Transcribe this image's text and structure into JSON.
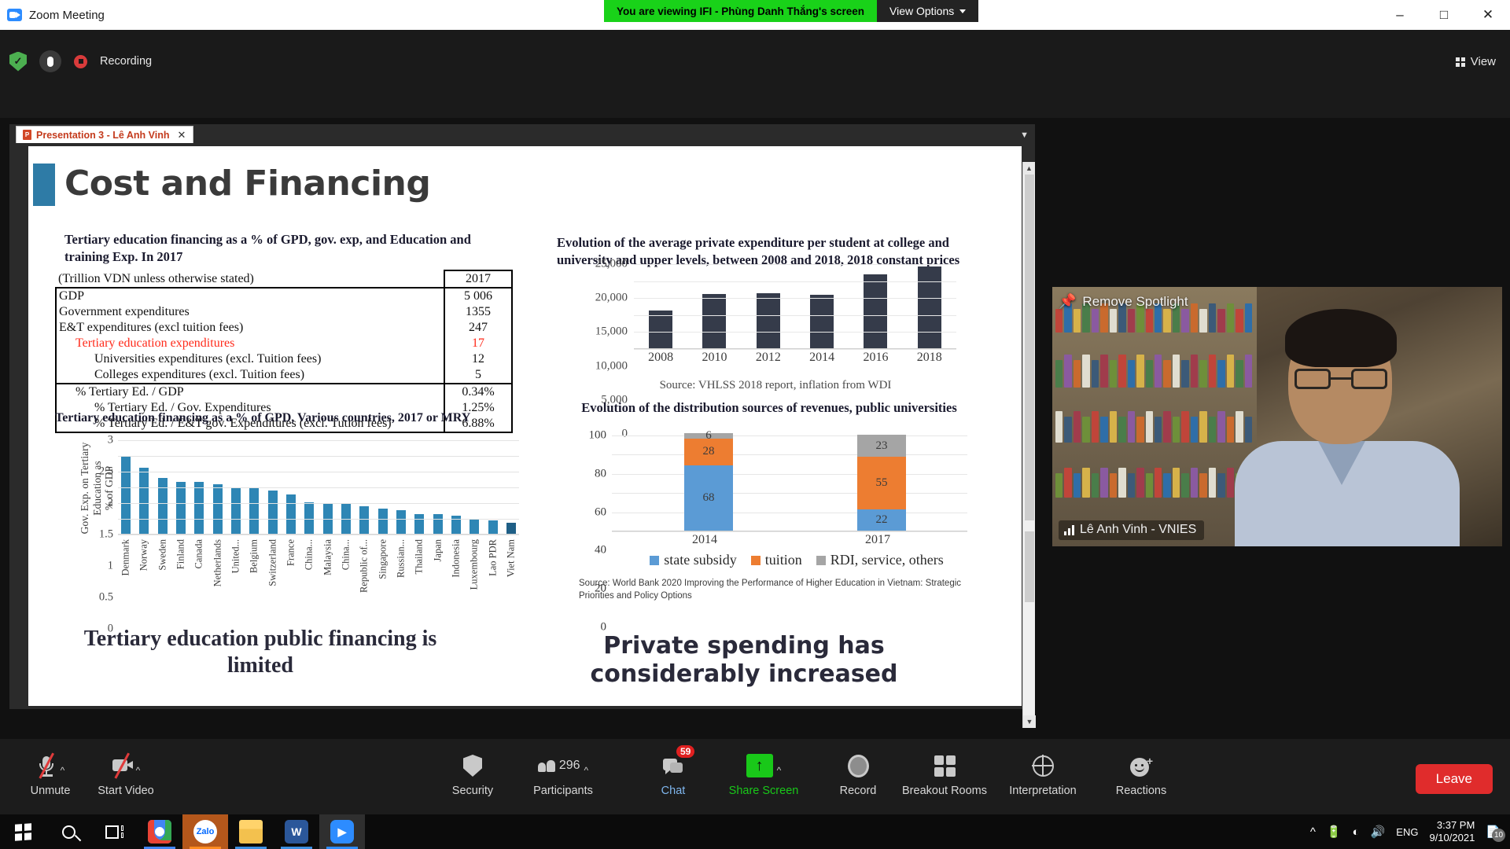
{
  "window": {
    "app_title": "Zoom Meeting",
    "viewing_banner": "You are viewing IFI - Phùng Danh Thắng's screen",
    "view_options": "View Options",
    "minimize": "–",
    "maximize": "□",
    "close": "✕"
  },
  "topbar": {
    "recording_label": "Recording",
    "view_label": "View"
  },
  "share_window": {
    "tab_label": "Presentation 3 - Lê Anh Vinh",
    "tab_close": "✕"
  },
  "slide": {
    "title": "Cost and Financing",
    "left_heading": "Tertiary education financing as a % of GPD, gov. exp, and Education and training Exp. In 2017",
    "table": {
      "header_label": "(Trillion VDN unless otherwise stated)",
      "header_value": "2017",
      "rows": [
        {
          "label": "GDP",
          "value": "5 006",
          "indent": 0,
          "red": false
        },
        {
          "label": "Government expenditures",
          "value": "1355",
          "indent": 0,
          "red": false
        },
        {
          "label": "E&T expenditures (excl tuition fees)",
          "value": "247",
          "indent": 0,
          "red": false
        },
        {
          "label": "Tertiary education expenditures",
          "value": "17",
          "indent": 1,
          "red": true
        },
        {
          "label": "Universities expenditures (excl. Tuition fees)",
          "value": "12",
          "indent": 2,
          "red": false
        },
        {
          "label": "Colleges expenditures (excl. Tuition fees)",
          "value": "5",
          "indent": 2,
          "red": false
        },
        {
          "label": "% Tertiary Ed. / GDP",
          "value": "0.34%",
          "indent": 1,
          "red": false
        },
        {
          "label": "% Tertiary Ed. / Gov. Expenditures",
          "value": "1.25%",
          "indent": 2,
          "red": false
        },
        {
          "label": "% Tertiary Ed. / E&T gov. Expenditures (excl. Tution fees)",
          "value": "6.88%",
          "indent": 2,
          "red": false
        }
      ]
    },
    "left_heading2": "Tertiary education financing as a % of GPD, Various countries, 2017 or MRY",
    "statement_left": "Tertiary education public financing is limited",
    "right_heading": "Evolution of the average private expenditure per student at college and university and upper levels, between 2008 and 2018, 2018 constant prices",
    "source_vhlss": "Source: VHLSS 2018 report, inflation from WDI",
    "stack_heading": "Evolution of the distribution sources of revenues, public universities",
    "source_wb": "Source: World Bank 2020 Improving the Performance of Higher Education in Vietnam: Strategic Priorities and Policy Options",
    "statement_right": "Private spending has considerably increased",
    "colors": {
      "accent_bar": "#2e7ba6",
      "bar_blue": "#2e86b5",
      "bar_dark": "#353b4a",
      "stack_blue": "#5b9bd5",
      "stack_orange": "#ed7d31",
      "stack_gray": "#a5a5a5",
      "highlight_red": "#ff2a1a"
    }
  },
  "chart_data": [
    {
      "type": "bar",
      "title": "Tertiary education financing as a % of GPD, Various countries, 2017 or MRY",
      "xlabel": "",
      "ylabel": "Gov. Exp. on Tertiary Education as % of GDP",
      "ylim": [
        0,
        3
      ],
      "yticks": [
        "0",
        "0.5",
        "1",
        "1.5",
        "2",
        "2.5",
        "3"
      ],
      "grid": true,
      "categories": [
        "Denmark",
        "Norway",
        "Sweden",
        "Finland",
        "Canada",
        "Netherlands",
        "United...",
        "Belgium",
        "Switzerland",
        "France",
        "China...",
        "Malaysia",
        "China...",
        "Republic of...",
        "Singapore",
        "Russian...",
        "Thailand",
        "Japan",
        "Indonesia",
        "Luxembourg",
        "Lao PDR",
        "Viet Nam"
      ],
      "values": [
        2.45,
        2.1,
        1.77,
        1.64,
        1.64,
        1.57,
        1.45,
        1.45,
        1.37,
        1.24,
        1.0,
        0.98,
        0.94,
        0.88,
        0.8,
        0.76,
        0.63,
        0.63,
        0.57,
        0.47,
        0.42,
        0.36
      ]
    },
    {
      "type": "bar",
      "title": "Evolution of the average private expenditure per student at college and university and upper levels, between 2008 and 2018, 2018 constant prices",
      "xlabel": "",
      "ylabel": "",
      "ylim": [
        0,
        25000
      ],
      "yticks": [
        "0",
        "5,000",
        "10,000",
        "15,000",
        "20,000",
        "25,000"
      ],
      "grid": true,
      "categories": [
        "2008",
        "2010",
        "2012",
        "2014",
        "2016",
        "2018"
      ],
      "values": [
        11000,
        16000,
        16300,
        15800,
        21800,
        24100
      ],
      "source": "Source: VHLSS 2018 report, inflation from WDI"
    },
    {
      "type": "bar",
      "stacked": true,
      "title": "Evolution of the distribution sources of revenues, public universities",
      "xlabel": "",
      "ylabel": "",
      "ylim": [
        0,
        100
      ],
      "yticks": [
        "0",
        "20",
        "40",
        "60",
        "80",
        "100"
      ],
      "grid": true,
      "categories": [
        "2014",
        "2017"
      ],
      "series": [
        {
          "name": "state subsidy",
          "values": [
            68,
            22
          ],
          "color": "#5b9bd5"
        },
        {
          "name": "tuition",
          "values": [
            28,
            55
          ],
          "color": "#ed7d31"
        },
        {
          "name": "RDI, service, others",
          "values": [
            6,
            23
          ],
          "color": "#a5a5a5"
        }
      ],
      "legend_position": "bottom",
      "source": "Source: World Bank 2020 Improving the Performance of Higher Education in Vietnam: Strategic Priorities and Policy Options"
    }
  ],
  "video": {
    "spotlight_label": "Remove Spotlight",
    "participant_name": "Lê Anh Vinh - VNIES"
  },
  "toolbar": {
    "items": [
      {
        "label": "Unmute",
        "icon": "microphone-muted-icon",
        "caret": true,
        "count": ""
      },
      {
        "label": "Start Video",
        "icon": "camera-off-icon",
        "caret": true,
        "count": ""
      },
      {
        "label": "Security",
        "icon": "shield-icon",
        "caret": false,
        "count": ""
      },
      {
        "label": "Participants",
        "icon": "people-icon",
        "caret": true,
        "count": "296"
      },
      {
        "label": "Chat",
        "icon": "chat-icon",
        "caret": false,
        "count": "59"
      },
      {
        "label": "Share Screen",
        "icon": "share-screen-icon",
        "caret": true,
        "count": ""
      },
      {
        "label": "Record",
        "icon": "record-icon",
        "caret": false,
        "count": ""
      },
      {
        "label": "Breakout Rooms",
        "icon": "breakout-rooms-icon",
        "caret": false,
        "count": ""
      },
      {
        "label": "Interpretation",
        "icon": "globe-icon",
        "caret": false,
        "count": ""
      },
      {
        "label": "Reactions",
        "icon": "reactions-icon",
        "caret": false,
        "count": ""
      }
    ],
    "leave_label": "Leave"
  },
  "taskbar": {
    "apps": [
      "chrome-icon",
      "zalo-icon",
      "file-explorer-icon",
      "word-icon",
      "zoom-icon"
    ],
    "zalo_label": "Zalo",
    "word_label": "W",
    "language": "ENG",
    "time": "3:37 PM",
    "date": "9/10/2021",
    "notification_count": "10"
  }
}
